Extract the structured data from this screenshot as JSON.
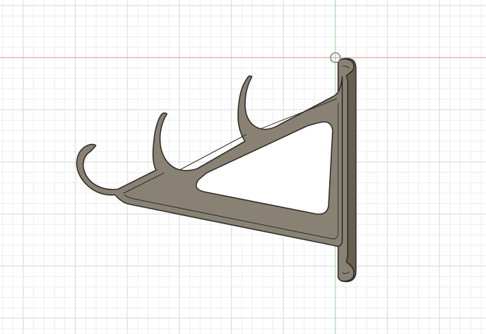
{
  "viewport": {
    "background": "#ffffff",
    "grid": {
      "minor_color": "#ececec",
      "major_color": "#d6d6d6",
      "x_axis_color": "#e08a82",
      "y_axis_color": "#8fd08f"
    },
    "model": {
      "fill_color": "#898274",
      "edge_color": "#2e2b25",
      "shadow_color": "#67604f",
      "icon": "cad-bracket-model"
    },
    "origin_marker": {
      "icon": "origin-circle-icon",
      "color": "#9a9a9a"
    }
  }
}
